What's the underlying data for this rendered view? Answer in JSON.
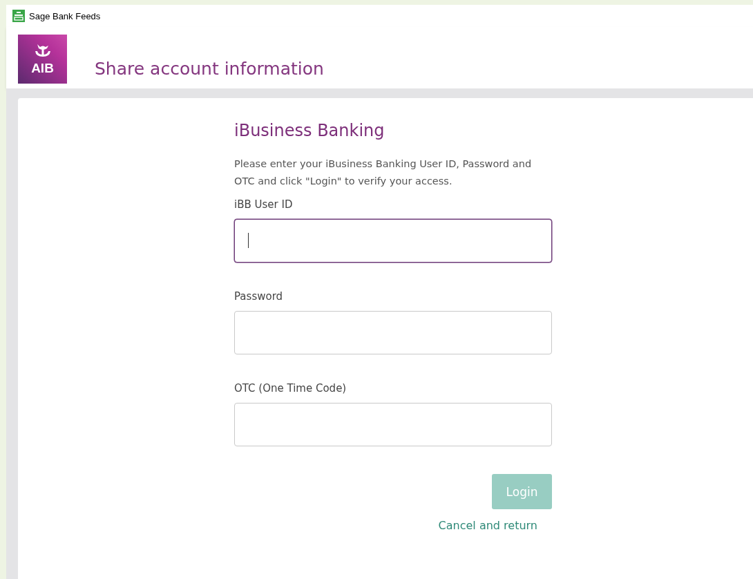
{
  "window": {
    "title": "Sage Bank Feeds"
  },
  "header": {
    "logo_text": "AIB",
    "title": "Share account information"
  },
  "form": {
    "heading": "iBusiness Banking",
    "intro": "Please enter your iBusiness Banking User ID, Password and OTC and click \"Login\" to verify your access.",
    "fields": [
      {
        "label": "iBB User ID",
        "focused": true
      },
      {
        "label": "Password",
        "focused": false
      },
      {
        "label": "OTC (One Time Code)",
        "focused": false
      }
    ],
    "login_button": {
      "label": "Login",
      "disabled": true
    },
    "cancel_link": "Cancel and return"
  }
}
